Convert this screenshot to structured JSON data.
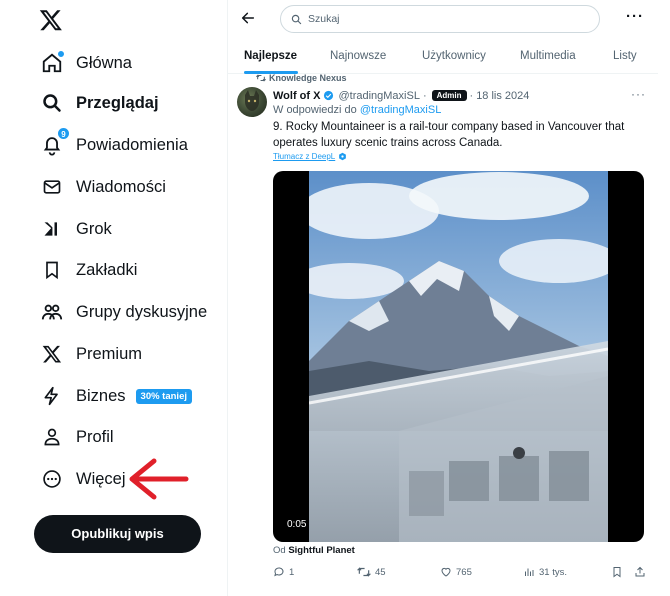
{
  "app": {
    "logo": "x-logo"
  },
  "sidebar": {
    "items": [
      {
        "label": "Główna",
        "icon": "home-icon"
      },
      {
        "label": "Przeglądaj",
        "icon": "search-icon",
        "active": true
      },
      {
        "label": "Powiadomienia",
        "icon": "bell-icon",
        "badge": "9"
      },
      {
        "label": "Wiadomości",
        "icon": "mail-icon"
      },
      {
        "label": "Grok",
        "icon": "grok-icon"
      },
      {
        "label": "Zakładki",
        "icon": "bookmark-icon"
      },
      {
        "label": "Grupy dyskusyjne",
        "icon": "communities-icon"
      },
      {
        "label": "Premium",
        "icon": "x-logo-icon"
      },
      {
        "label": "Biznes",
        "icon": "lightning-icon",
        "promo": "30% taniej"
      },
      {
        "label": "Profil",
        "icon": "person-icon"
      },
      {
        "label": "Więcej",
        "icon": "more-circle-icon"
      }
    ],
    "post_button": "Opublikuj wpis"
  },
  "search": {
    "placeholder": "Szukaj"
  },
  "tabs": [
    "Najlepsze",
    "Najnowsze",
    "Użytkownicy",
    "Multimedia",
    "Listy"
  ],
  "tweet": {
    "repost_label": "Knowledge Nexus",
    "name": "Wolf of X",
    "handle": "@tradingMaxiSL",
    "badge": "Admin",
    "separator": "·",
    "date": "18 lis 2024",
    "reply_prefix": "W odpowiedzi do",
    "reply_handle": "@tradingMaxiSL",
    "text": "9. Rocky Mountaineer is a rail-tour company based in Vancouver that operates luxury scenic trains across Canada.",
    "translate": "Tłumacz z DeepL",
    "video_time": "0:05",
    "from_prefix": "Od",
    "from_source": "Sightful Planet",
    "stats": {
      "replies": "1",
      "reposts": "45",
      "likes": "765",
      "views": "31 tys."
    }
  },
  "colors": {
    "accent": "#1d9bf0",
    "text": "#0f1419",
    "muted": "#536471",
    "arrow": "#e0202a"
  }
}
